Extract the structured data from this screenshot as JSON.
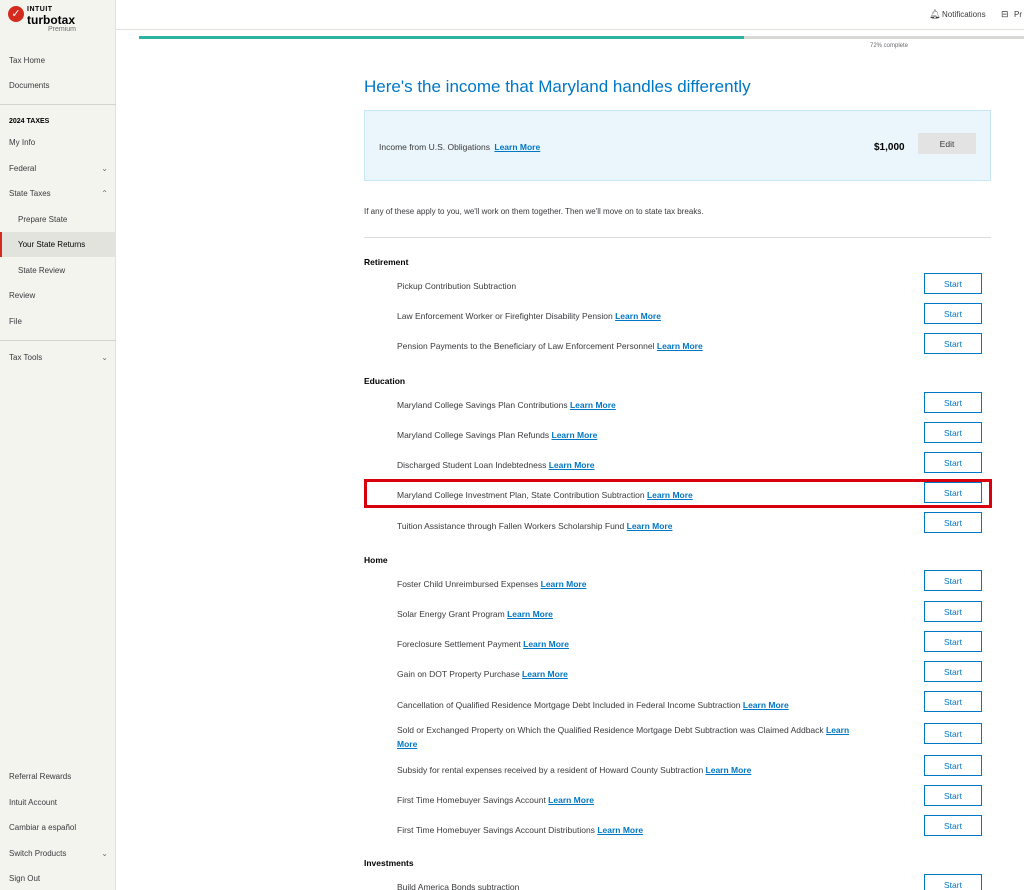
{
  "logo": {
    "brand_small": "INTUIT",
    "brand": "turbotax",
    "edition": "Premium"
  },
  "sidebar": {
    "tax_home": "Tax Home",
    "documents": "Documents",
    "section_label": "2024 TAXES",
    "my_info": "My Info",
    "federal": "Federal",
    "state_taxes": "State Taxes",
    "prepare_state": "Prepare State",
    "your_state_returns": "Your State Returns",
    "state_review": "State Review",
    "review": "Review",
    "file": "File",
    "tax_tools": "Tax Tools",
    "referral_rewards": "Referral Rewards",
    "intuit_account": "Intuit Account",
    "cambiar": "Cambiar a español",
    "switch_products": "Switch Products",
    "sign_out": "Sign Out"
  },
  "header": {
    "notifications": "Notifications",
    "products": "Pr"
  },
  "progress": {
    "percent": 72,
    "label": "72% complete"
  },
  "main": {
    "title": "Here's the income that Maryland handles differently",
    "income_label": "Income from U.S. Obligations",
    "income_amount": "$1,000",
    "edit_label": "Edit",
    "intro": "If any of these apply to you, we'll work on them together. Then we'll move on to state tax breaks.",
    "learn_more": "Learn More",
    "start_label": "Start"
  },
  "sections": {
    "retirement": "Retirement",
    "education": "Education",
    "home": "Home",
    "investments": "Investments"
  },
  "rows": [
    {
      "text": "Pickup Contribution Subtraction",
      "learn": ""
    },
    {
      "text": "Law Enforcement Worker or Firefighter Disability Pension",
      "learn": "Learn More"
    },
    {
      "text": "Pension Payments to the Beneficiary of Law Enforcement Personnel",
      "learn": "Learn More"
    },
    {
      "text": "Maryland College Savings Plan Contributions",
      "learn": "Learn More"
    },
    {
      "text": "Maryland College Savings Plan Refunds",
      "learn": "Learn More"
    },
    {
      "text": "Discharged Student Loan Indebtedness",
      "learn": "Learn More"
    },
    {
      "text": "Maryland College Investment Plan, State Contribution Subtraction",
      "learn": "Learn More"
    },
    {
      "text": "Tuition Assistance through Fallen Workers Scholarship Fund",
      "learn": "Learn More"
    },
    {
      "text": "Foster Child Unreimbursed Expenses",
      "learn": "Learn More"
    },
    {
      "text": "Solar Energy Grant Program",
      "learn": "Learn More"
    },
    {
      "text": "Foreclosure Settlement Payment",
      "learn": "Learn More"
    },
    {
      "text": "Gain on DOT Property Purchase",
      "learn": "Learn More"
    },
    {
      "text": "Cancellation of Qualified Residence Mortgage Debt Included in Federal Income Subtraction",
      "learn": "Learn More"
    },
    {
      "text": "Sold or Exchanged Property on Which the Qualified Residence Mortgage Debt Subtraction was Claimed Addback",
      "learn": "Learn More"
    },
    {
      "text": "Subsidy for rental expenses received by a resident of Howard County Subtraction",
      "learn": "Learn More"
    },
    {
      "text": "First Time Homebuyer Savings Account",
      "learn": "Learn More"
    },
    {
      "text": "First Time Homebuyer Savings Account Distributions",
      "learn": "Learn More"
    },
    {
      "text": "Build America Bonds subtraction",
      "learn": ""
    }
  ],
  "colors": {
    "accent": "#0077c5",
    "progress": "#2ab3a3",
    "highlight": "#d8000c",
    "brand": "#d52b1e"
  }
}
